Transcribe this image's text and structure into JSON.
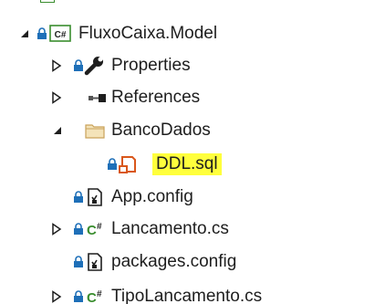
{
  "tree": {
    "items": [
      {
        "label": "FluxoCaixa.Model",
        "icon": "csharp-project-icon",
        "expander": "expanded"
      },
      {
        "label": "Properties",
        "icon": "wrench-icon",
        "expander": "collapsed"
      },
      {
        "label": "References",
        "icon": "references-icon",
        "expander": "collapsed"
      },
      {
        "label": "BancoDados",
        "icon": "folder-icon",
        "expander": "expanded"
      },
      {
        "label": "DDL.sql",
        "icon": "sql-file-icon",
        "expander": "none",
        "highlight": "#ffff3c"
      },
      {
        "label": "App.config",
        "icon": "config-file-icon",
        "expander": "none"
      },
      {
        "label": "Lancamento.cs",
        "icon": "csharp-file-icon",
        "expander": "collapsed"
      },
      {
        "label": "packages.config",
        "icon": "config-file-icon",
        "expander": "none"
      },
      {
        "label": "TipoLancamento.cs",
        "icon": "csharp-file-icon",
        "expander": "collapsed"
      }
    ]
  },
  "colors": {
    "lock_blue": "#1e6fb8",
    "csharp_green": "#3a8d2e",
    "sql_orange": "#d9571b",
    "folder_tan": "#dcb67a",
    "highlight": "#ffff3c"
  }
}
